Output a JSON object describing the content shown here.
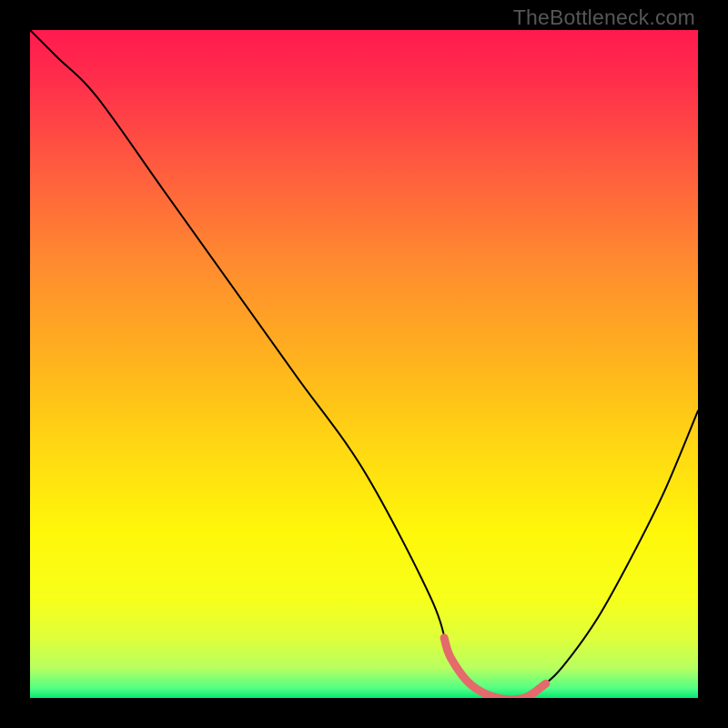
{
  "watermark": "TheBottleneck.com",
  "chart_data": {
    "type": "line",
    "title": "",
    "xlabel": "",
    "ylabel": "",
    "xlim": [
      0,
      100
    ],
    "ylim": [
      0,
      100
    ],
    "grid": false,
    "legend": false,
    "series": [
      {
        "name": "bottleneck-curve",
        "x": [
          0,
          4,
          10,
          20,
          30,
          40,
          50,
          60,
          63,
          66,
          70,
          74,
          77,
          80,
          85,
          90,
          95,
          100
        ],
        "values": [
          100,
          96,
          90,
          76,
          62,
          48,
          34,
          15,
          6,
          2,
          0,
          0,
          2,
          5,
          12,
          21,
          31,
          43
        ]
      }
    ],
    "highlight": {
      "name": "bottom-band",
      "x_start": 62,
      "x_end": 77,
      "color": "#e46a6c"
    },
    "background_gradient": {
      "stops": [
        {
          "offset": 0.0,
          "color": "#ff1a4f"
        },
        {
          "offset": 0.08,
          "color": "#ff2f4b"
        },
        {
          "offset": 0.2,
          "color": "#ff5a3f"
        },
        {
          "offset": 0.35,
          "color": "#ff8b2f"
        },
        {
          "offset": 0.5,
          "color": "#ffb41d"
        },
        {
          "offset": 0.63,
          "color": "#ffd912"
        },
        {
          "offset": 0.75,
          "color": "#fff70a"
        },
        {
          "offset": 0.85,
          "color": "#f7ff1a"
        },
        {
          "offset": 0.91,
          "color": "#dfff3a"
        },
        {
          "offset": 0.955,
          "color": "#b8ff60"
        },
        {
          "offset": 0.985,
          "color": "#55ff84"
        },
        {
          "offset": 1.0,
          "color": "#05e874"
        }
      ]
    }
  }
}
